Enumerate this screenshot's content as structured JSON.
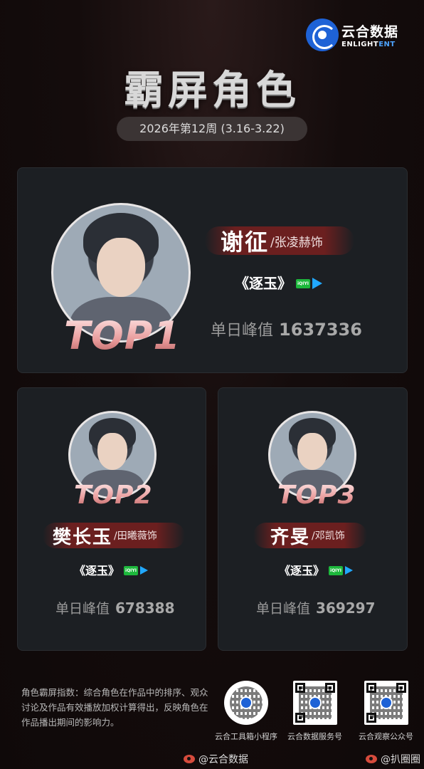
{
  "brand": {
    "name_cn": "云合数据",
    "name_en_a": "ENLIGHT",
    "name_en_b": "ENT"
  },
  "title": "霸屏角色",
  "week": "2026年第12周 (3.16-3.22)",
  "colors": {
    "accent_red": "#6b1f1f",
    "card_bg": "#1c1f23",
    "iqiyi_green": "#1db83c",
    "tencent_blue": "#21a8ff"
  },
  "rankings": [
    {
      "rank_label": "TOP1",
      "name": "谢征",
      "actor": "/张凌赫饰",
      "drama": "《逐玉》",
      "platforms": [
        "iqiyi-icon",
        "tencent-video-icon"
      ],
      "peak_label": "单日峰值",
      "peak_value": "1637336"
    },
    {
      "rank_label": "TOP2",
      "name": "樊长玉",
      "actor": "/田曦薇饰",
      "drama": "《逐玉》",
      "platforms": [
        "iqiyi-icon",
        "tencent-video-icon"
      ],
      "peak_label": "单日峰值",
      "peak_value": "678388"
    },
    {
      "rank_label": "TOP3",
      "name": "齐旻",
      "actor": "/邓凯饰",
      "drama": "《逐玉》",
      "platforms": [
        "iqiyi-icon",
        "tencent-video-icon"
      ],
      "peak_label": "单日峰值",
      "peak_value": "369297"
    }
  ],
  "iqiyi_text": "iQIYI",
  "description": "角色霸屏指数：综合角色在作品中的排序、观众讨论及作品有效播放加权计算得出，反映角色在作品播出期间的影响力。",
  "qr_codes": [
    {
      "caption": "云合工具箱小程序"
    },
    {
      "caption": "云合数据服务号"
    },
    {
      "caption": "云合观察公众号"
    }
  ],
  "watermarks": {
    "left": "@云合数据",
    "right": "@扒圈圈"
  }
}
